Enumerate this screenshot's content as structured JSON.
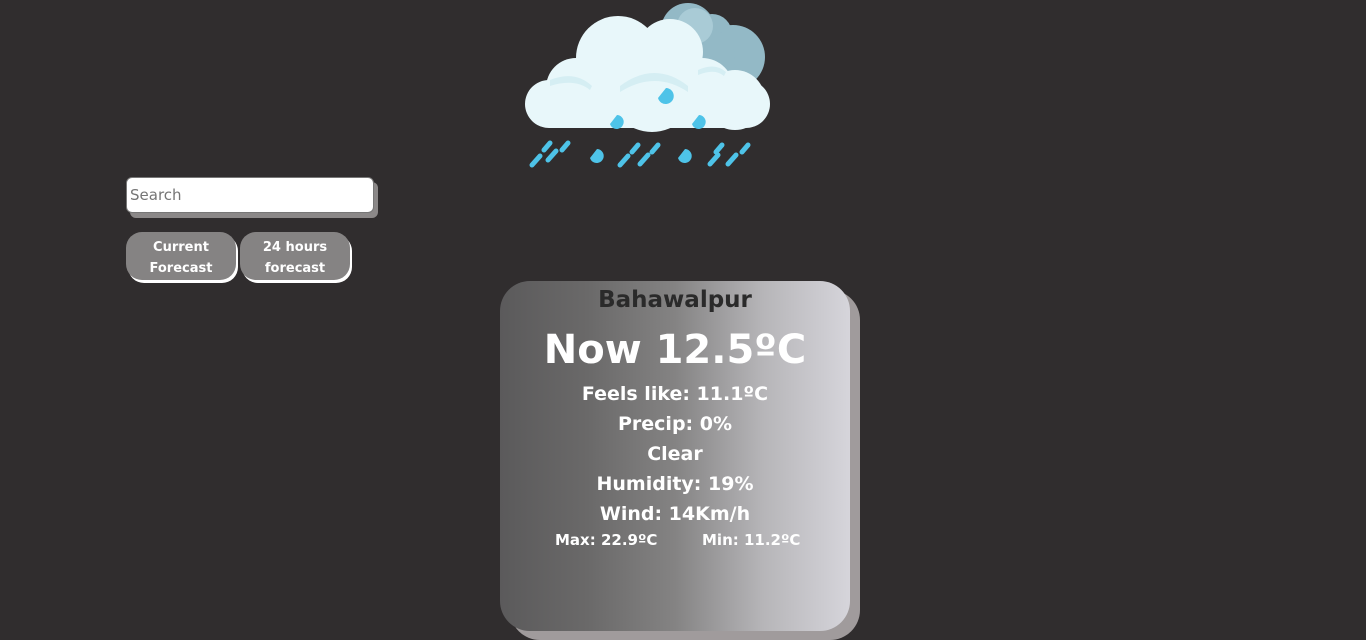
{
  "illustration": {
    "icon": "rain-cloud-icon"
  },
  "search": {
    "placeholder": "Search",
    "value": ""
  },
  "buttons": {
    "current_line1": "Current",
    "current_line2": "Forecast",
    "hourly_line1": "24 hours",
    "hourly_line2": "forecast"
  },
  "weather": {
    "city": "Bahawalpur",
    "now": "Now 12.5ºC",
    "feels_like": "Feels like: 11.1ºC",
    "precip": "Precip: 0%",
    "condition": "Clear",
    "humidity": "Humidity: 19%",
    "wind": "Wind: 14Km/h",
    "max": "Max: 22.9ºC",
    "min": "Min: 11.2ºC"
  },
  "colors": {
    "background": "#302d2e",
    "button": "#858383",
    "cloud": "#e6f7fa",
    "rain": "#4ec3e8"
  }
}
